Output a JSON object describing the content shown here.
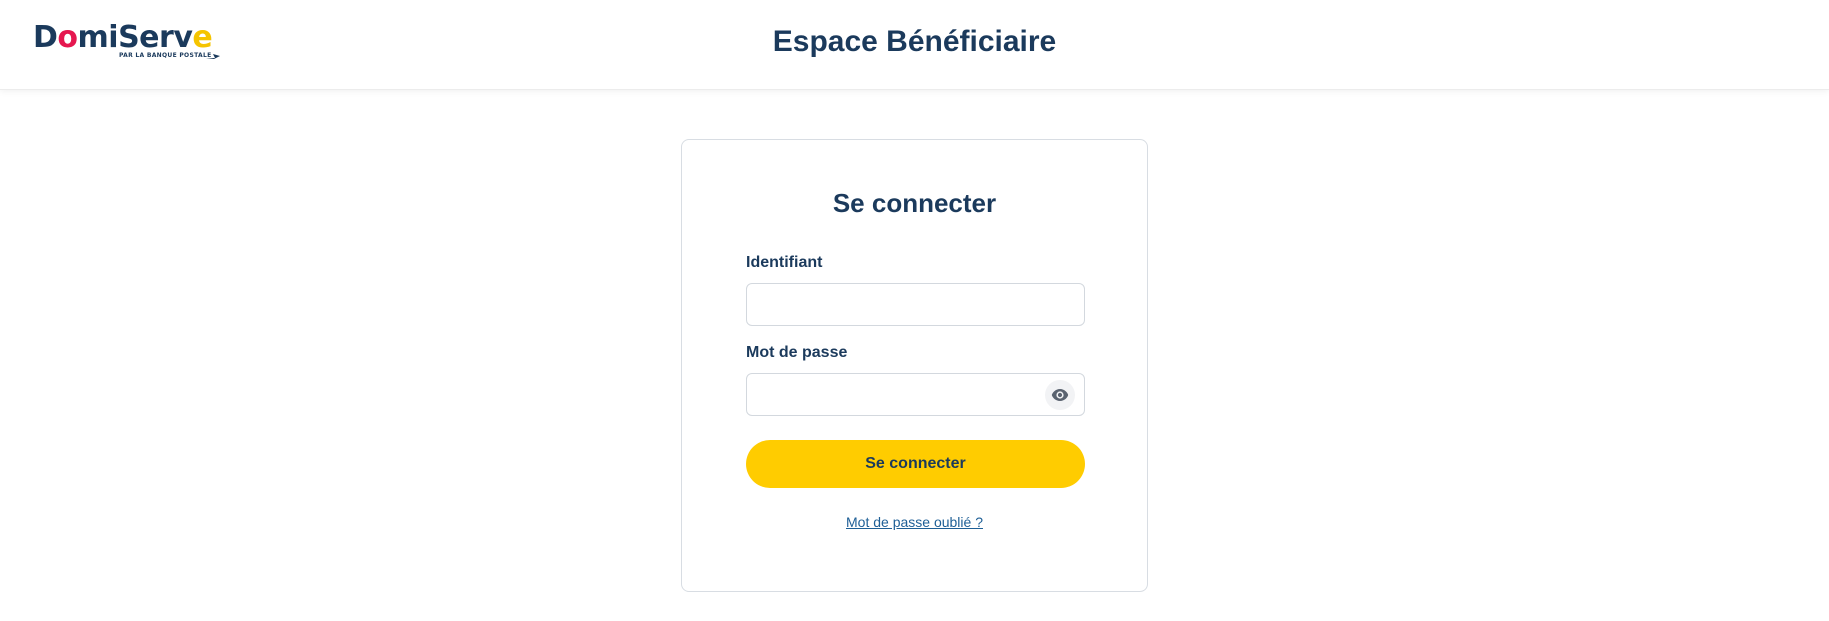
{
  "header": {
    "logo": {
      "brand": "DomiServe",
      "tagline": "PAR LA BANQUE POSTALE"
    },
    "title": "Espace Bénéficiaire"
  },
  "login": {
    "title": "Se connecter",
    "identifier_label": "Identifiant",
    "identifier_value": "",
    "password_label": "Mot de passe",
    "password_value": "",
    "show_password_icon": "eye-icon",
    "submit_label": "Se connecter",
    "forgot_link": "Mot de passe oublié ?"
  },
  "colors": {
    "primary_text": "#1b3a5c",
    "accent_yellow": "#ffcc00",
    "brand_pink": "#e5174f",
    "link": "#1e5f96",
    "card_border": "#d8dde3"
  }
}
